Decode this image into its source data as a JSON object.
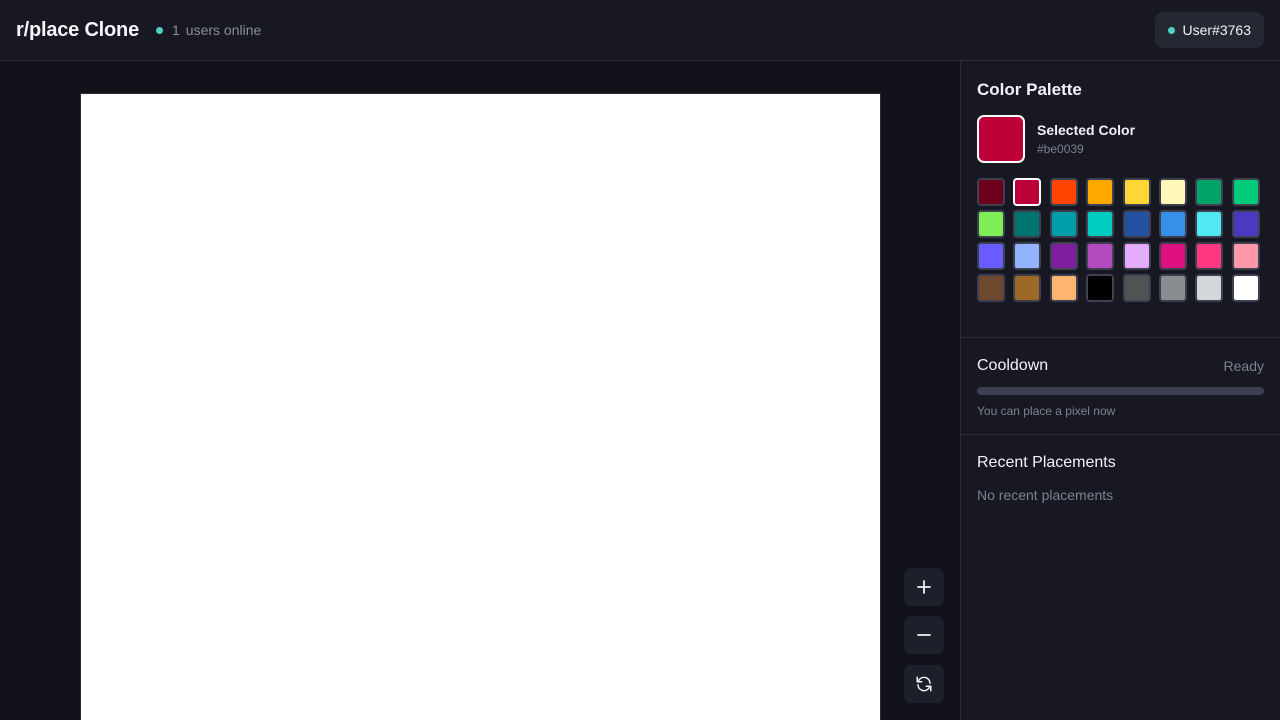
{
  "header": {
    "title": "r/place Clone",
    "online_count": "1",
    "online_label": "users online",
    "online_dot_color": "#4fd1c5",
    "user": "User#3763"
  },
  "canvas": {
    "background": "#ffffff",
    "controls": [
      {
        "name": "zoom-in-button",
        "icon": "plus-icon",
        "glyph": "+"
      },
      {
        "name": "zoom-out-button",
        "icon": "minus-icon",
        "glyph": "−"
      },
      {
        "name": "reset-view-button",
        "icon": "refresh-icon",
        "glyph": "↻"
      }
    ]
  },
  "palette": {
    "title": "Color Palette",
    "selected_label": "Selected Color",
    "selected_hex": "#be0039",
    "colors": [
      "#6d001a",
      "#be0039",
      "#ff4500",
      "#ffa800",
      "#ffd635",
      "#fff8b8",
      "#00a368",
      "#00cc78",
      "#7eed56",
      "#00756f",
      "#009eaa",
      "#00ccc0",
      "#2450a4",
      "#3690ea",
      "#51e9f4",
      "#493ac1",
      "#6a5cff",
      "#94b3ff",
      "#811e9f",
      "#b44ac0",
      "#e4abff",
      "#de107f",
      "#ff3881",
      "#ff99aa",
      "#6d482f",
      "#9c6926",
      "#ffb470",
      "#000000",
      "#515252",
      "#898d90",
      "#d4d7d9",
      "#ffffff"
    ]
  },
  "cooldown": {
    "title": "Cooldown",
    "status": "Ready",
    "progress": 0,
    "message": "You can place a pixel now"
  },
  "recent": {
    "title": "Recent Placements",
    "empty": "No recent placements"
  }
}
